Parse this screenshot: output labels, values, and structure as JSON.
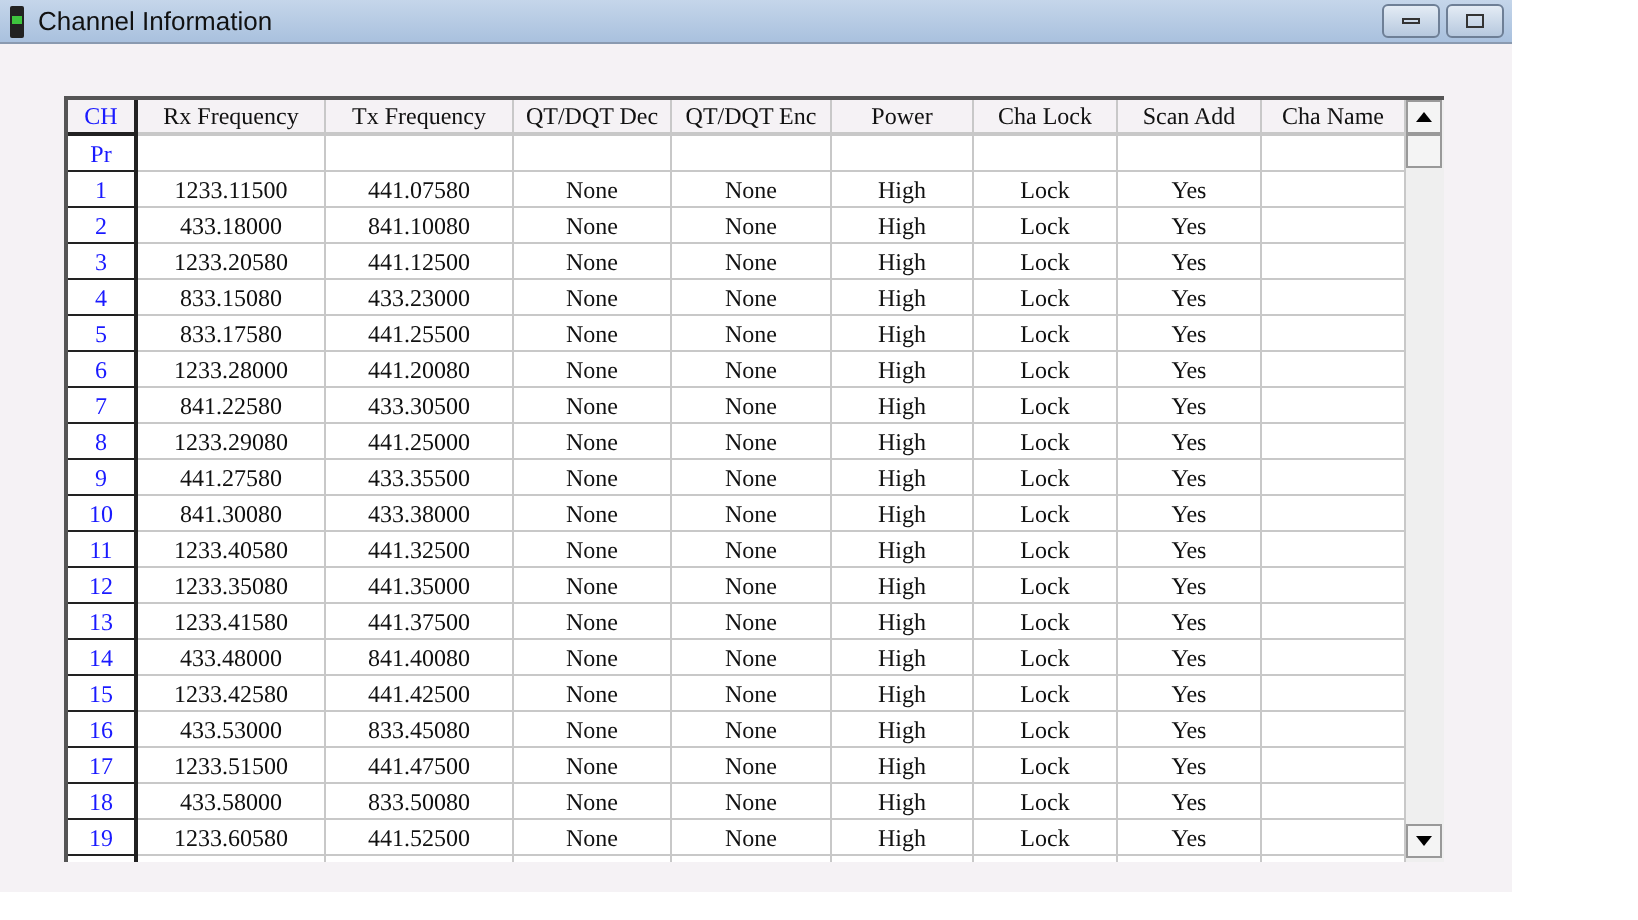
{
  "window": {
    "title": "Channel Information"
  },
  "table": {
    "columns": [
      "CH",
      "Rx Frequency",
      "Tx Frequency",
      "QT/DQT Dec",
      "QT/DQT Enc",
      "Power",
      "Cha Lock",
      "Scan Add",
      "Cha Name"
    ],
    "subheader": "Pr",
    "rows": [
      [
        "1",
        "1233.11500",
        "441.07580",
        "None",
        "None",
        "High",
        "Lock",
        "Yes"
      ],
      [
        "2",
        "433.18000",
        "841.10080",
        "None",
        "None",
        "High",
        "Lock",
        "Yes"
      ],
      [
        "3",
        "1233.20580",
        "441.12500",
        "None",
        "None",
        "High",
        "Lock",
        "Yes"
      ],
      [
        "4",
        "833.15080",
        "433.23000",
        "None",
        "None",
        "High",
        "Lock",
        "Yes"
      ],
      [
        "5",
        "833.17580",
        "441.25500",
        "None",
        "None",
        "High",
        "Lock",
        "Yes"
      ],
      [
        "6",
        "1233.28000",
        "441.20080",
        "None",
        "None",
        "High",
        "Lock",
        "Yes"
      ],
      [
        "7",
        "841.22580",
        "433.30500",
        "None",
        "None",
        "High",
        "Lock",
        "Yes"
      ],
      [
        "8",
        "1233.29080",
        "441.25000",
        "None",
        "None",
        "High",
        "Lock",
        "Yes"
      ],
      [
        "9",
        "441.27580",
        "433.35500",
        "None",
        "None",
        "High",
        "Lock",
        "Yes"
      ],
      [
        "10",
        "841.30080",
        "433.38000",
        "None",
        "None",
        "High",
        "Lock",
        "Yes"
      ],
      [
        "11",
        "1233.40580",
        "441.32500",
        "None",
        "None",
        "High",
        "Lock",
        "Yes"
      ],
      [
        "12",
        "1233.35080",
        "441.35000",
        "None",
        "None",
        "High",
        "Lock",
        "Yes"
      ],
      [
        "13",
        "1233.41580",
        "441.37500",
        "None",
        "None",
        "High",
        "Lock",
        "Yes"
      ],
      [
        "14",
        "433.48000",
        "841.40080",
        "None",
        "None",
        "High",
        "Lock",
        "Yes"
      ],
      [
        "15",
        "1233.42580",
        "441.42500",
        "None",
        "None",
        "High",
        "Lock",
        "Yes"
      ],
      [
        "16",
        "433.53000",
        "833.45080",
        "None",
        "None",
        "High",
        "Lock",
        "Yes"
      ],
      [
        "17",
        "1233.51500",
        "441.47500",
        "None",
        "None",
        "High",
        "Lock",
        "Yes"
      ],
      [
        "18",
        "433.58000",
        "833.50080",
        "None",
        "None",
        "High",
        "Lock",
        "Yes"
      ],
      [
        "19",
        "1233.60580",
        "441.52500",
        "None",
        "None",
        "High",
        "Lock",
        "Yes"
      ]
    ]
  }
}
